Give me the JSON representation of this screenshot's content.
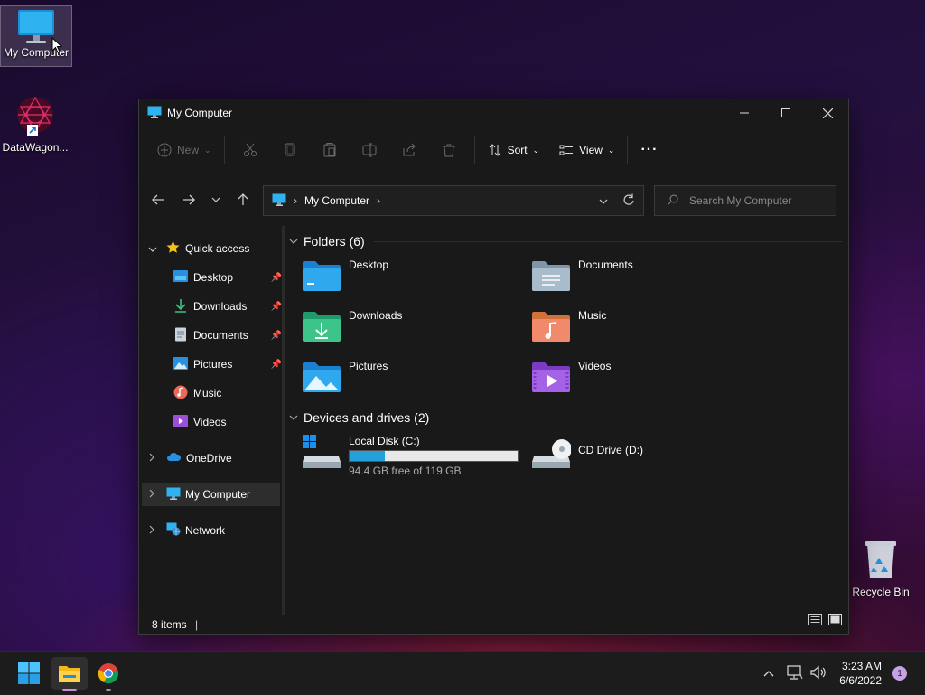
{
  "desktop": {
    "icons": [
      {
        "label": "My Computer"
      },
      {
        "label": "DataWagon..."
      },
      {
        "label": "Recycle Bin"
      }
    ]
  },
  "window": {
    "title": "My Computer",
    "toolbar": {
      "new_label": "New",
      "sort_label": "Sort",
      "view_label": "View",
      "more_label": "···"
    },
    "address": {
      "path": [
        "My Computer"
      ]
    },
    "search": {
      "placeholder": "Search My Computer"
    },
    "nav": {
      "quick_access": "Quick access",
      "quick_items": [
        {
          "label": "Desktop",
          "pinned": true
        },
        {
          "label": "Downloads",
          "pinned": true
        },
        {
          "label": "Documents",
          "pinned": true
        },
        {
          "label": "Pictures",
          "pinned": true
        },
        {
          "label": "Music",
          "pinned": false
        },
        {
          "label": "Videos",
          "pinned": false
        }
      ],
      "onedrive": "OneDrive",
      "my_computer": "My Computer",
      "network": "Network"
    },
    "folders_header": "Folders (6)",
    "folders": [
      {
        "label": "Desktop"
      },
      {
        "label": "Documents"
      },
      {
        "label": "Downloads"
      },
      {
        "label": "Music"
      },
      {
        "label": "Pictures"
      },
      {
        "label": "Videos"
      }
    ],
    "drives_header": "Devices and drives (2)",
    "drives": [
      {
        "label": "Local Disk (C:)",
        "free_text": "94.4 GB free of 119 GB",
        "used_fraction": 0.207
      },
      {
        "label": "CD Drive (D:)"
      }
    ],
    "status": "8 items"
  },
  "taskbar": {
    "time": "3:23 AM",
    "date": "6/6/2022",
    "notification_count": "1"
  },
  "colors": {
    "accent": "#0078d4",
    "drive_bar": "#26a0da"
  }
}
